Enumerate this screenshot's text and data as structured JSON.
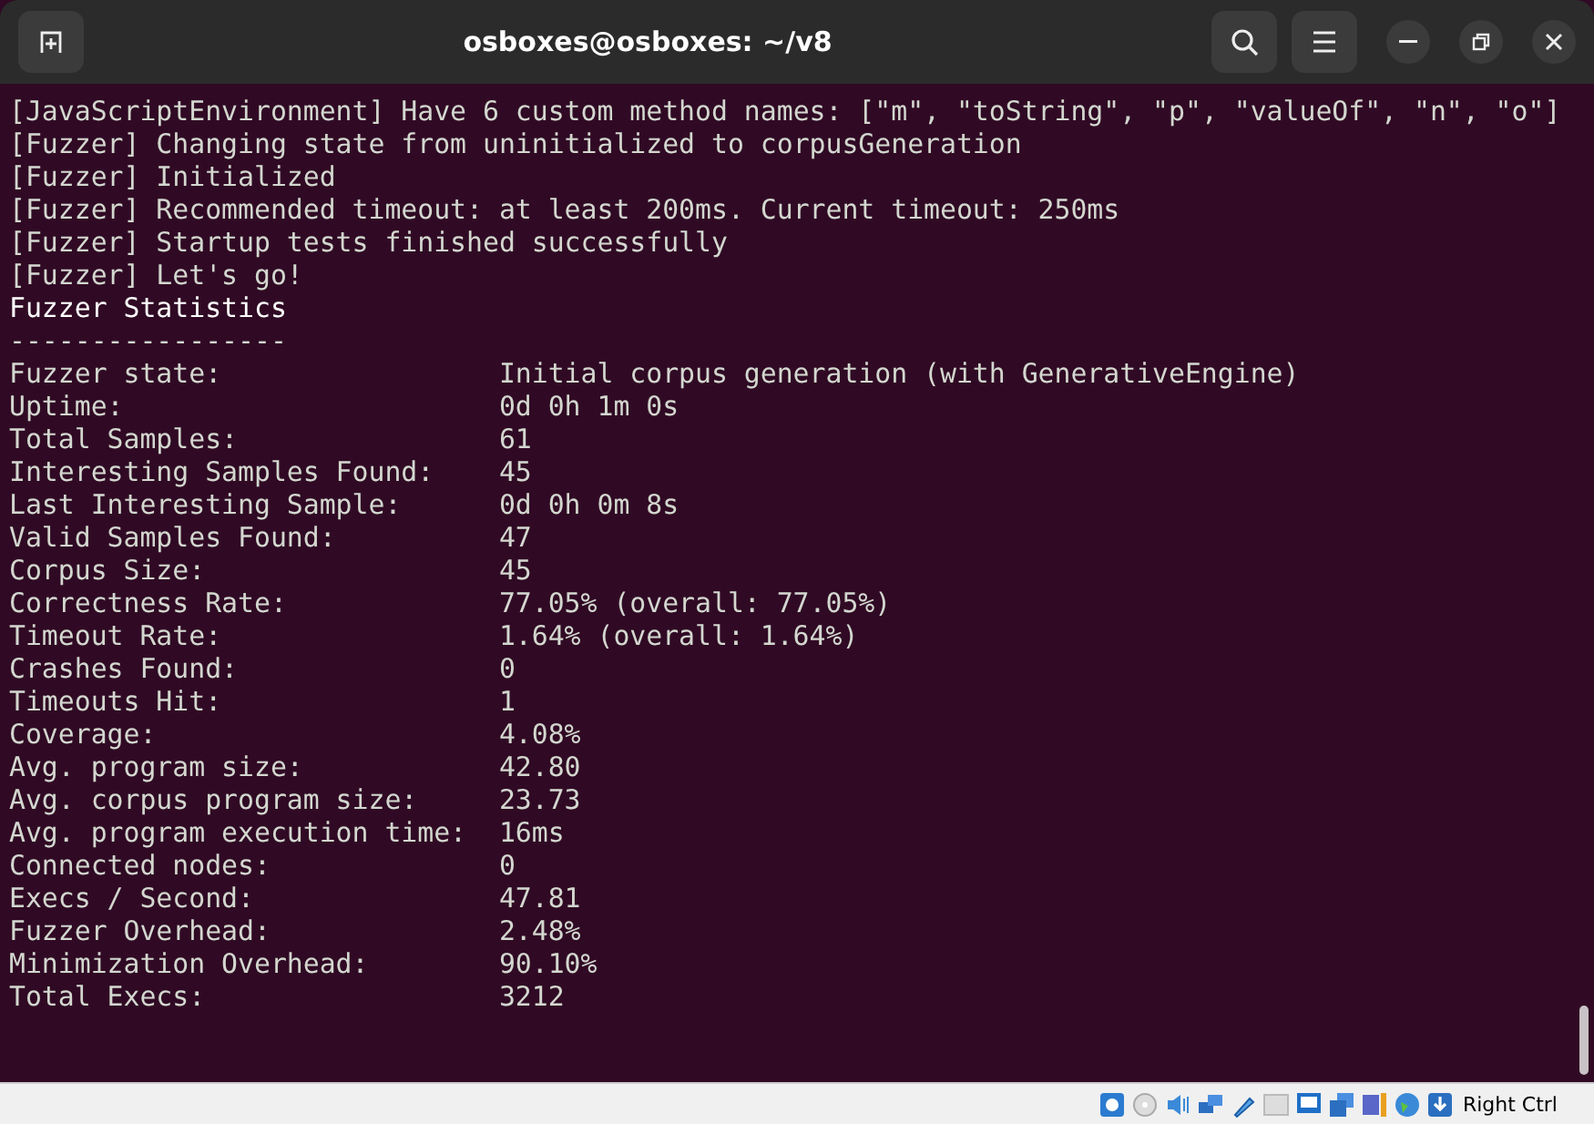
{
  "window": {
    "title": "osboxes@osboxes: ~/v8"
  },
  "log_lines": [
    "[JavaScriptEnvironment] Have 6 custom method names: [\"m\", \"toString\", \"p\", \"valueOf\", \"n\", \"o\"]",
    "[Fuzzer] Changing state from uninitialized to corpusGeneration",
    "[Fuzzer] Initialized",
    "[Fuzzer] Recommended timeout: at least 200ms. Current timeout: 250ms",
    "[Fuzzer] Startup tests finished successfully",
    "[Fuzzer] Let's go!"
  ],
  "stats": {
    "heading": "Fuzzer Statistics",
    "rule": "-----------------",
    "rows": [
      {
        "label": "Fuzzer state:",
        "value": "Initial corpus generation (with GenerativeEngine)"
      },
      {
        "label": "Uptime:",
        "value": "0d 0h 1m 0s"
      },
      {
        "label": "Total Samples:",
        "value": "61"
      },
      {
        "label": "Interesting Samples Found:",
        "value": "45"
      },
      {
        "label": "Last Interesting Sample:",
        "value": "0d 0h 0m 8s"
      },
      {
        "label": "Valid Samples Found:",
        "value": "47"
      },
      {
        "label": "Corpus Size:",
        "value": "45"
      },
      {
        "label": "Correctness Rate:",
        "value": "77.05% (overall: 77.05%)"
      },
      {
        "label": "Timeout Rate:",
        "value": "1.64% (overall: 1.64%)"
      },
      {
        "label": "Crashes Found:",
        "value": "0"
      },
      {
        "label": "Timeouts Hit:",
        "value": "1"
      },
      {
        "label": "Coverage:",
        "value": "4.08%"
      },
      {
        "label": "Avg. program size:",
        "value": "42.80"
      },
      {
        "label": "Avg. corpus program size:",
        "value": "23.73"
      },
      {
        "label": "Avg. program execution time:",
        "value": "16ms"
      },
      {
        "label": "Connected nodes:",
        "value": "0"
      },
      {
        "label": "Execs / Second:",
        "value": "47.81"
      },
      {
        "label": "Fuzzer Overhead:",
        "value": "2.48%"
      },
      {
        "label": "Minimization Overhead:",
        "value": "90.10%"
      },
      {
        "label": "Total Execs:",
        "value": "3212"
      }
    ]
  },
  "status_bar": {
    "host_key": "Right Ctrl"
  }
}
